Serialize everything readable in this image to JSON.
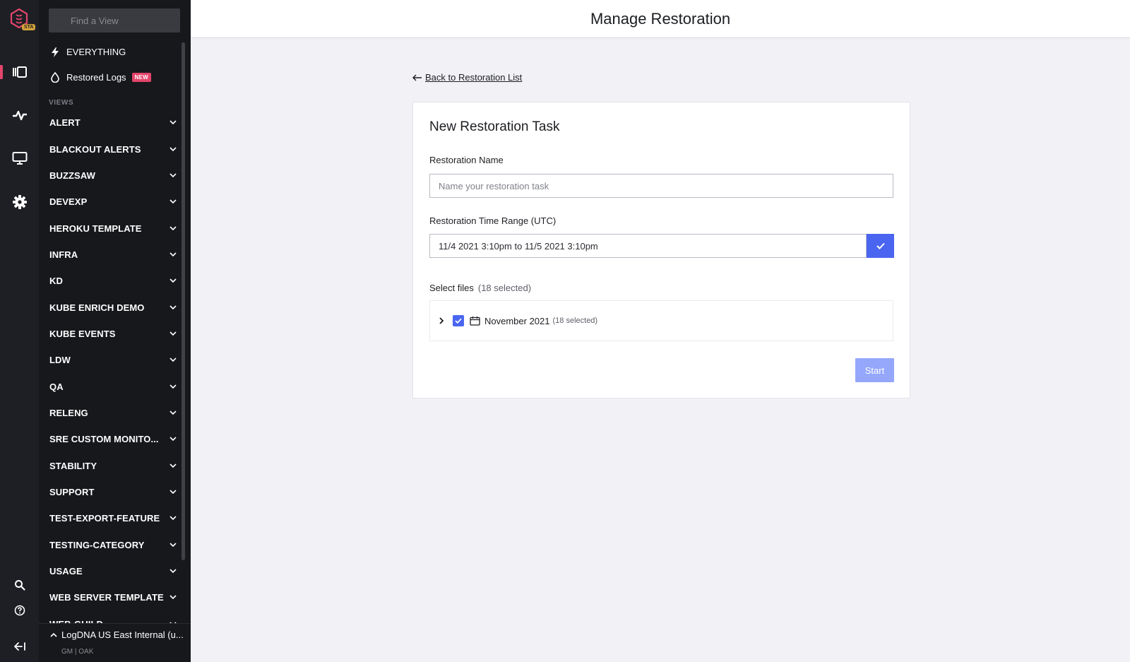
{
  "rail": {
    "badge": "STA",
    "items": [
      {
        "icon": "views-icon",
        "active": true
      },
      {
        "icon": "pulse-icon"
      },
      {
        "icon": "monitor-icon"
      },
      {
        "icon": "gear-icon"
      }
    ],
    "bottom_icons": [
      "search-icon",
      "help-icon",
      "collapse-icon"
    ]
  },
  "sidebar": {
    "search_placeholder": "Find a View",
    "everything_label": "EVERYTHING",
    "restored_logs_label": "Restored Logs",
    "new_badge": "NEW",
    "section_label": "VIEWS",
    "views": [
      "ALERT",
      "BLACKOUT ALERTS",
      "BUZZSAW",
      "DEVEXP",
      "HEROKU TEMPLATE",
      "INFRA",
      "KD",
      "KUBE ENRICH DEMO",
      "KUBE EVENTS",
      "LDW",
      "QA",
      "RELENG",
      "SRE CUSTOM MONITO...",
      "STABILITY",
      "SUPPORT",
      "TEST-EXPORT-FEATURE",
      "TESTING-CATEGORY",
      "USAGE",
      "WEB SERVER TEMPLATE",
      "WEB-GUILD"
    ],
    "org_name": "LogDNA US East Internal (u...",
    "org_meta": "GM | OAK"
  },
  "page": {
    "title": "Manage Restoration",
    "back_link": "Back to Restoration List"
  },
  "form": {
    "card_title": "New Restoration Task",
    "name_label": "Restoration Name",
    "name_placeholder": "Name your restoration task",
    "name_value": "",
    "range_label": "Restoration Time Range (UTC)",
    "range_value": "11/4 2021 3:10pm to 11/5 2021 3:10pm",
    "files_label": "Select files",
    "files_count": "(18 selected)",
    "tree": {
      "label": "November 2021",
      "count": "(18 selected)",
      "checked": true,
      "expanded": false
    },
    "start_label": "Start"
  },
  "colors": {
    "accent": "#4a66f0",
    "accent_disabled": "#94a7fb",
    "brand": "#e4456b",
    "sidebar_bg": "#17181c",
    "rail_bg": "#1e1f25",
    "page_bg": "#f1f1f6"
  }
}
